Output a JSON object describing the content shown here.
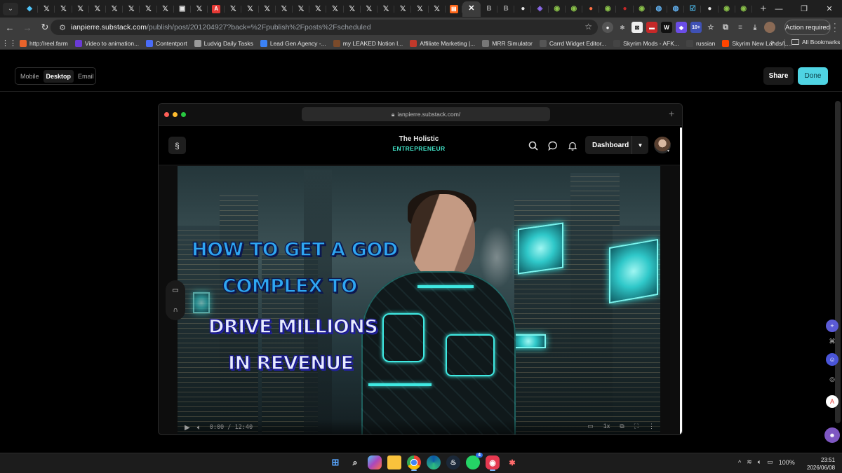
{
  "browser": {
    "tab_icons": [
      "diamond-icon",
      "x-logo-icon",
      "x-logo-icon",
      "x-logo-icon",
      "x-logo-icon",
      "x-logo-icon",
      "x-logo-icon",
      "x-logo-icon",
      "x-logo-icon",
      "monitor-icon",
      "x-logo-icon",
      "pdf-icon",
      "x-logo-icon",
      "x-logo-icon",
      "x-logo-icon",
      "x-logo-icon",
      "x-logo-icon",
      "x-logo-icon",
      "x-logo-icon",
      "x-logo-icon",
      "x-logo-icon",
      "x-logo-icon",
      "x-logo-icon",
      "x-logo-icon",
      "x-logo-icon",
      "substack-icon",
      "close-icon",
      "b-icon",
      "b-icon",
      "circle-icon",
      "shield-icon",
      "chrome-icon",
      "chrome-icon",
      "orange-circle-icon",
      "chrome-icon",
      "red-circle-icon",
      "chrome-icon",
      "globe-icon",
      "globe-icon",
      "checkbox-icon",
      "circle-icon",
      "chrome-icon",
      "chrome-icon"
    ],
    "url_host": "ianpierre.substack.com",
    "url_path": "/publish/post/201204927?back=%2Fpublish%2Fposts%2Fscheduled",
    "action_required_label": "Action required",
    "extension_badge": "10+",
    "bookmarks": [
      {
        "label": "http://reel.farm",
        "icon": "reel-icon",
        "color": "#e8632b"
      },
      {
        "label": "Video to animation...",
        "icon": "v-icon",
        "color": "#6a3bd6"
      },
      {
        "label": "Contentport",
        "icon": "heart-icon",
        "color": "#4a6cf7"
      },
      {
        "label": "Ludvig Daily Tasks",
        "icon": "check-icon",
        "color": "#9a9a9a"
      },
      {
        "label": "Lead Gen Agency -...",
        "icon": "docs-icon",
        "color": "#3b82f6"
      },
      {
        "label": "my LEAKED Notion l...",
        "icon": "notion-icon",
        "color": "#7a4a2a"
      },
      {
        "label": "Affiliate Marketing |...",
        "icon": "target-icon",
        "color": "#c0392b"
      },
      {
        "label": "MRR Simulator",
        "icon": "gear-icon",
        "color": "#777"
      },
      {
        "label": "Carrd Widget Editor...",
        "icon": "carrd-icon",
        "color": "#555"
      },
      {
        "label": "Skyrim Mods - AFK...",
        "icon": "skyrim-icon",
        "color": "#444"
      },
      {
        "label": "russian",
        "icon": "page-icon",
        "color": "#444"
      },
      {
        "label": "Skyrim New Lands/L...",
        "icon": "reddit-icon",
        "color": "#ff4500"
      }
    ],
    "all_bookmarks_label": "All Bookmarks"
  },
  "editor": {
    "modes": [
      "Mobile",
      "Desktop",
      "Email"
    ],
    "active_mode": "Desktop",
    "share_label": "Share",
    "done_label": "Done",
    "accent_color": "#4fd4e3"
  },
  "preview": {
    "mock_url": "ianpierre.substack.com/",
    "publication_line1": "The Holistic",
    "publication_line2": "ENTREPRENEUR",
    "dashboard_label": "Dashboard",
    "hero_lines": [
      "HOW TO GET A GOD",
      "COMPLEX TO",
      "DRIVE MILLIONS",
      "IN REVENUE"
    ],
    "video_time": "0:00 / 12:40"
  },
  "taskbar": {
    "apps": [
      "windows-icon",
      "search-icon",
      "copilot-icon",
      "files-icon",
      "chrome-icon",
      "edge-icon",
      "steam-icon",
      "whatsapp-icon",
      "screen-recorder-icon",
      "paint-icon"
    ],
    "whatsapp_badge": "4",
    "battery": "100%",
    "time": "23:51",
    "date": "2026/06/08"
  }
}
